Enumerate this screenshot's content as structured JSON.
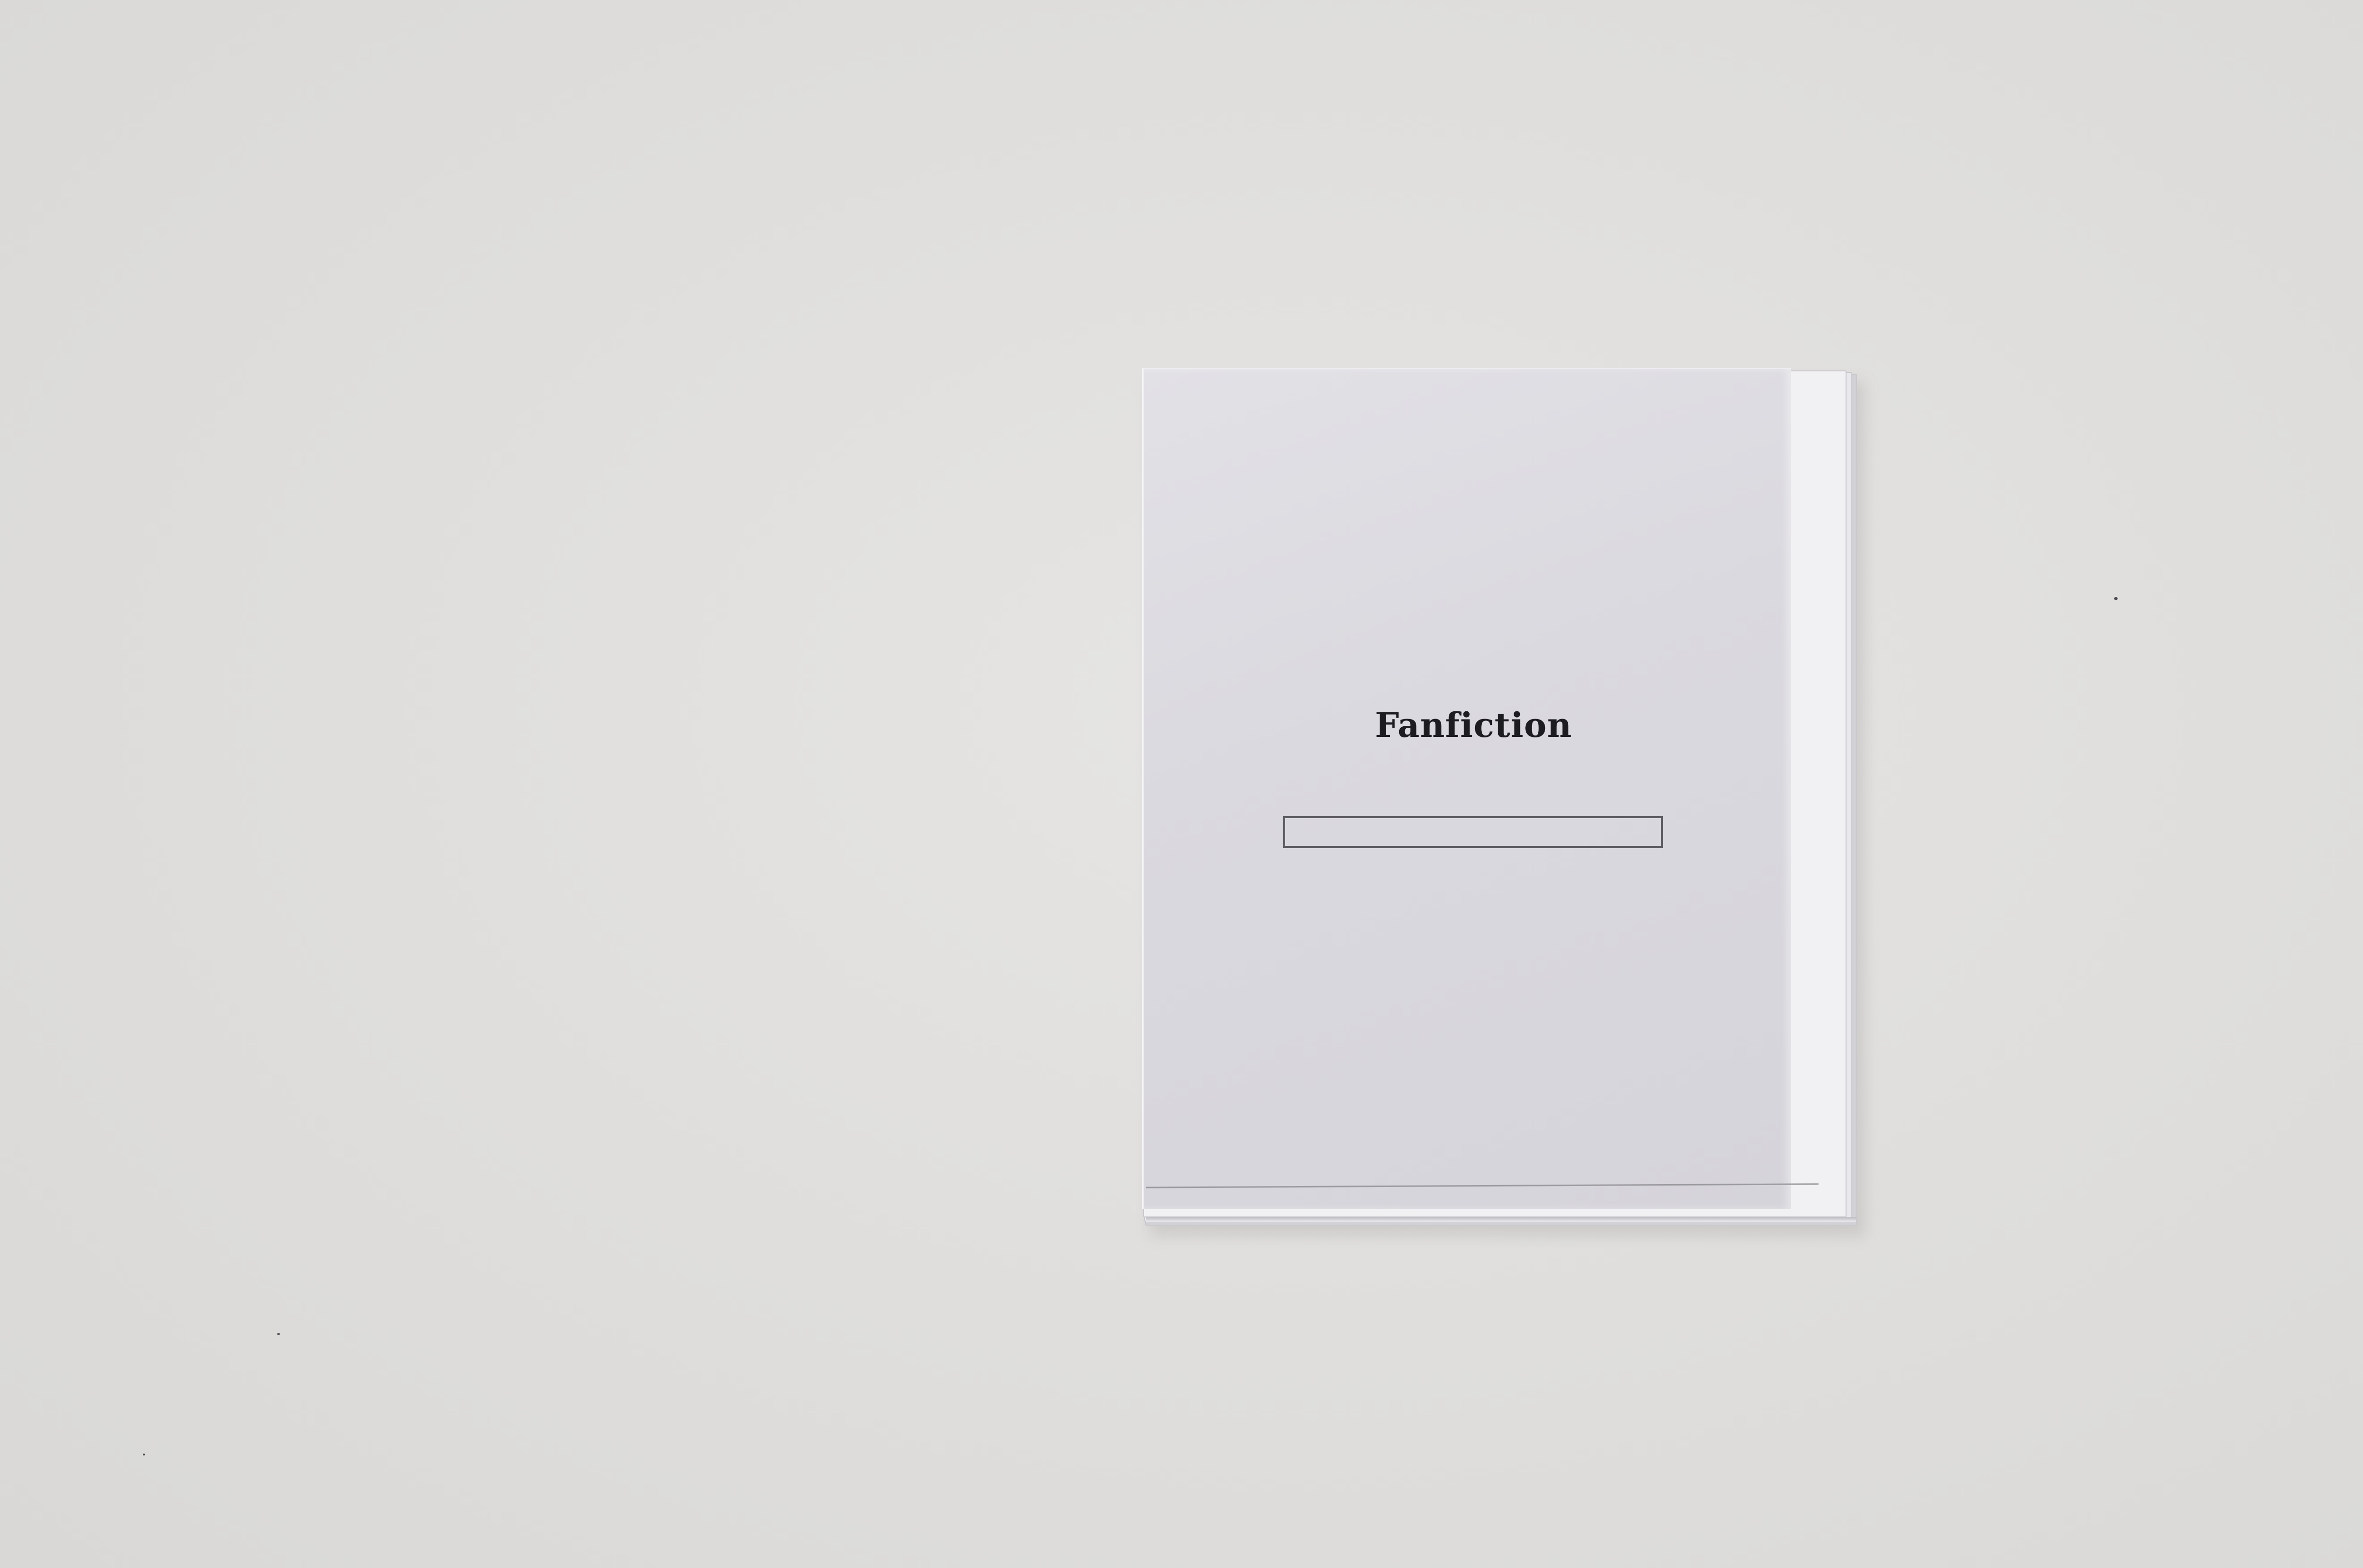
{
  "booklet": {
    "title": "Fanfiction"
  },
  "colors": {
    "background": "#e0dfdd",
    "cover": "#dad9df",
    "title_text": "#1d1c20",
    "box_border": "#5f5e64"
  }
}
